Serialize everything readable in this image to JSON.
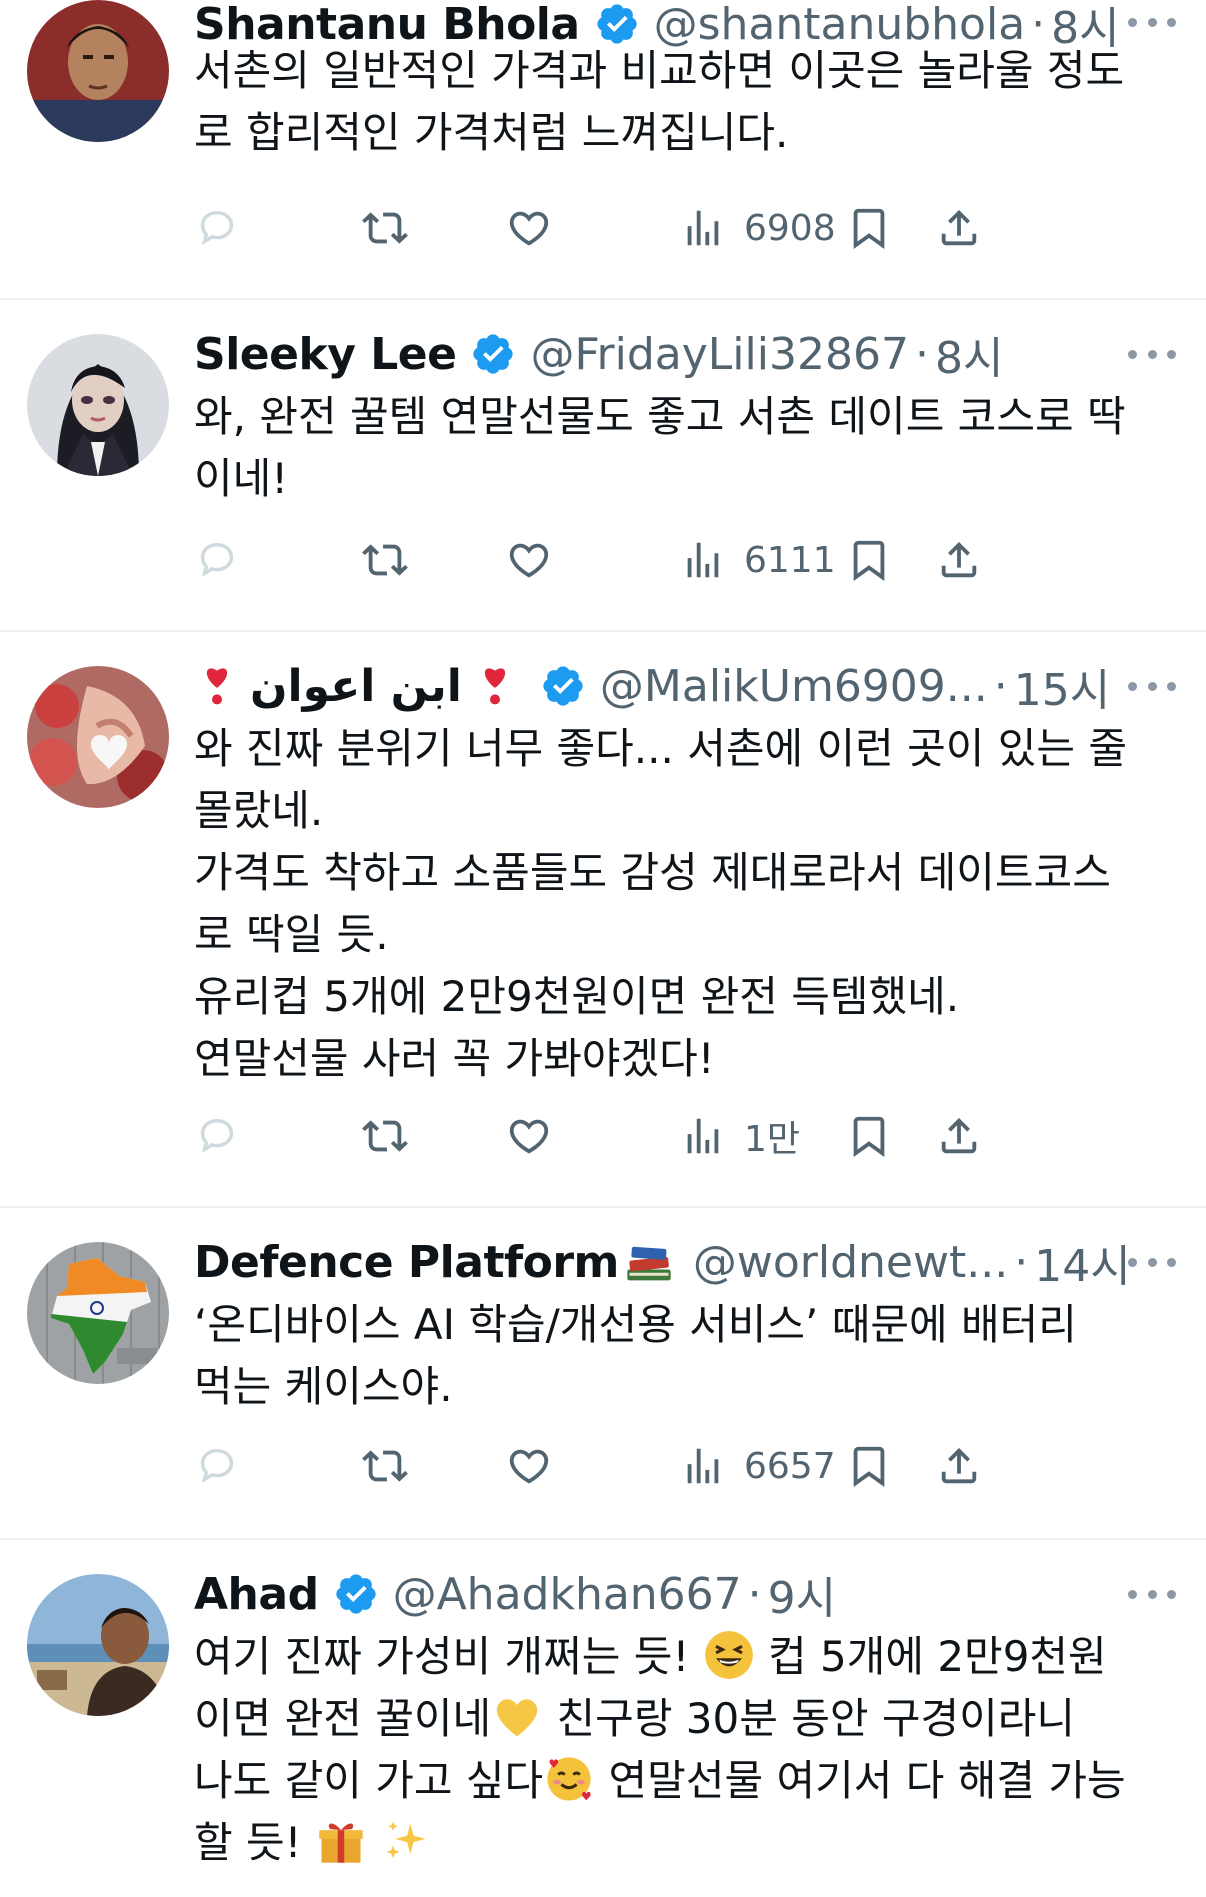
{
  "colors": {
    "verified": "#1d9bf0",
    "text": "#0f1419",
    "secondary": "#536471",
    "divider": "#eff3f4",
    "reply_icon_muted": "#cfd9de"
  },
  "icons": [
    "reply-icon",
    "retweet-icon",
    "like-icon",
    "views-icon",
    "bookmark-icon",
    "share-icon",
    "verified-badge-icon",
    "more-icon"
  ],
  "tweets": [
    {
      "name": "Shantanu Bhola",
      "handle": "@shantanubhola",
      "time": "8시",
      "lines": [
        "서촌의 일반적인 가격과 비교하면 이곳은 놀라울 정도",
        "로 합리적인 가격처럼 느껴집니다."
      ],
      "views": "6908"
    },
    {
      "name": "Sleeky Lee",
      "handle": "@FridayLili32867",
      "time": "8시",
      "lines": [
        "와, 완전 꿀템  연말선물도 좋고 서촌 데이트 코스로 딱",
        "이네!"
      ],
      "views": "6111"
    },
    {
      "name": "ابن اعوان",
      "handle": "@MalikUm6909...",
      "time": "15시",
      "lines": [
        "와 진짜 분위기 너무 좋다... 서촌에 이런 곳이 있는 줄",
        "몰랐네.",
        "가격도 착하고 소품들도 감성 제대로라서 데이트코스",
        "로 딱일 듯.",
        "유리컵 5개에 2만9천원이면 완전 득템했네.",
        "연말선물 사러 꼭 가봐야겠다!"
      ],
      "views": "1만"
    },
    {
      "name": "Defence Platform",
      "handle": "@worldnewt...",
      "time": "14시",
      "lines": [
        "‘온디바이스 AI 학습/개선용 서비스’ 때문에 배터리",
        "먹는 케이스야."
      ],
      "views": "6657"
    },
    {
      "name": "Ahad",
      "handle": "@Ahadkhan667",
      "time": "9시",
      "line1a": "여기 진짜 가성비 개쩌는 듯! ",
      "line1b": " 컵 5개에 2만9천원",
      "line2a": "이면 완전 꿀이네",
      "line2b": " 친구랑 30분 동안 구경이라니",
      "line3a": "나도 같이 가고 싶다",
      "line3b": " 연말선물 여기서 다 해결 가능",
      "line4a": "할 듯! "
    }
  ]
}
